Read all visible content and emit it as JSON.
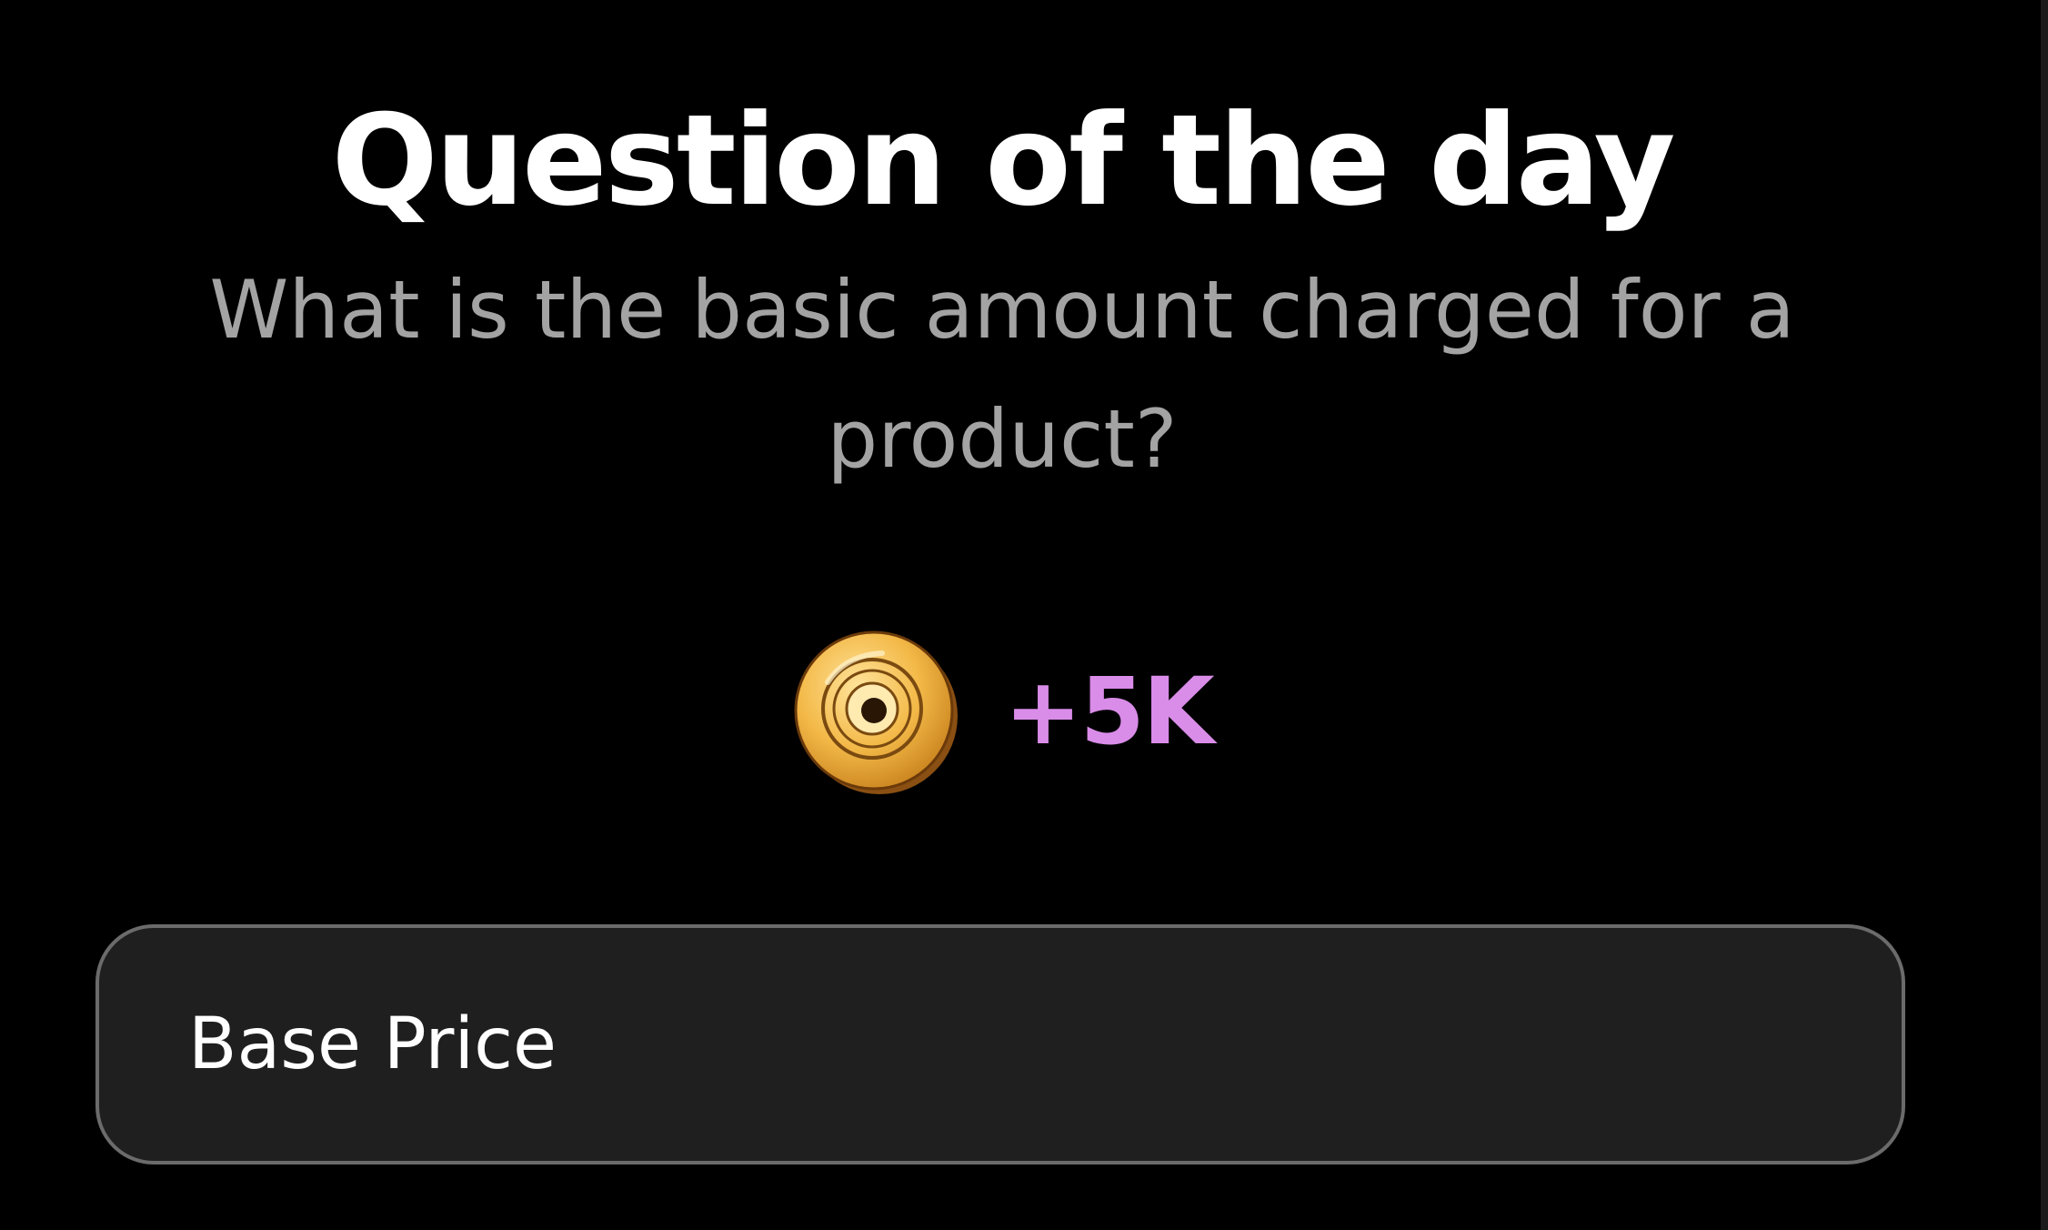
{
  "header": {
    "title": "Question of the day"
  },
  "question": {
    "text": "What is the basic amount charged for a product?"
  },
  "reward": {
    "icon": "coin-icon",
    "amount": "+5K",
    "color": "#d98ce8"
  },
  "answers": [
    {
      "label": "Base Price"
    }
  ]
}
